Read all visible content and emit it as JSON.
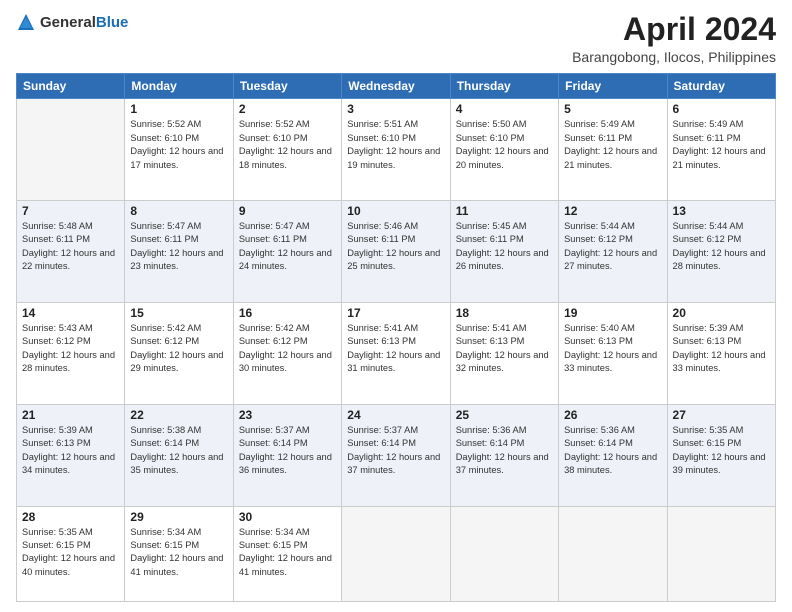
{
  "header": {
    "logo_general": "General",
    "logo_blue": "Blue",
    "month": "April 2024",
    "location": "Barangobong, Ilocos, Philippines"
  },
  "days_of_week": [
    "Sunday",
    "Monday",
    "Tuesday",
    "Wednesday",
    "Thursday",
    "Friday",
    "Saturday"
  ],
  "weeks": [
    [
      {
        "day": "",
        "sunrise": "",
        "sunset": "",
        "daylight": ""
      },
      {
        "day": "1",
        "sunrise": "Sunrise: 5:52 AM",
        "sunset": "Sunset: 6:10 PM",
        "daylight": "Daylight: 12 hours and 17 minutes."
      },
      {
        "day": "2",
        "sunrise": "Sunrise: 5:52 AM",
        "sunset": "Sunset: 6:10 PM",
        "daylight": "Daylight: 12 hours and 18 minutes."
      },
      {
        "day": "3",
        "sunrise": "Sunrise: 5:51 AM",
        "sunset": "Sunset: 6:10 PM",
        "daylight": "Daylight: 12 hours and 19 minutes."
      },
      {
        "day": "4",
        "sunrise": "Sunrise: 5:50 AM",
        "sunset": "Sunset: 6:10 PM",
        "daylight": "Daylight: 12 hours and 20 minutes."
      },
      {
        "day": "5",
        "sunrise": "Sunrise: 5:49 AM",
        "sunset": "Sunset: 6:11 PM",
        "daylight": "Daylight: 12 hours and 21 minutes."
      },
      {
        "day": "6",
        "sunrise": "Sunrise: 5:49 AM",
        "sunset": "Sunset: 6:11 PM",
        "daylight": "Daylight: 12 hours and 21 minutes."
      }
    ],
    [
      {
        "day": "7",
        "sunrise": "Sunrise: 5:48 AM",
        "sunset": "Sunset: 6:11 PM",
        "daylight": "Daylight: 12 hours and 22 minutes."
      },
      {
        "day": "8",
        "sunrise": "Sunrise: 5:47 AM",
        "sunset": "Sunset: 6:11 PM",
        "daylight": "Daylight: 12 hours and 23 minutes."
      },
      {
        "day": "9",
        "sunrise": "Sunrise: 5:47 AM",
        "sunset": "Sunset: 6:11 PM",
        "daylight": "Daylight: 12 hours and 24 minutes."
      },
      {
        "day": "10",
        "sunrise": "Sunrise: 5:46 AM",
        "sunset": "Sunset: 6:11 PM",
        "daylight": "Daylight: 12 hours and 25 minutes."
      },
      {
        "day": "11",
        "sunrise": "Sunrise: 5:45 AM",
        "sunset": "Sunset: 6:11 PM",
        "daylight": "Daylight: 12 hours and 26 minutes."
      },
      {
        "day": "12",
        "sunrise": "Sunrise: 5:44 AM",
        "sunset": "Sunset: 6:12 PM",
        "daylight": "Daylight: 12 hours and 27 minutes."
      },
      {
        "day": "13",
        "sunrise": "Sunrise: 5:44 AM",
        "sunset": "Sunset: 6:12 PM",
        "daylight": "Daylight: 12 hours and 28 minutes."
      }
    ],
    [
      {
        "day": "14",
        "sunrise": "Sunrise: 5:43 AM",
        "sunset": "Sunset: 6:12 PM",
        "daylight": "Daylight: 12 hours and 28 minutes."
      },
      {
        "day": "15",
        "sunrise": "Sunrise: 5:42 AM",
        "sunset": "Sunset: 6:12 PM",
        "daylight": "Daylight: 12 hours and 29 minutes."
      },
      {
        "day": "16",
        "sunrise": "Sunrise: 5:42 AM",
        "sunset": "Sunset: 6:12 PM",
        "daylight": "Daylight: 12 hours and 30 minutes."
      },
      {
        "day": "17",
        "sunrise": "Sunrise: 5:41 AM",
        "sunset": "Sunset: 6:13 PM",
        "daylight": "Daylight: 12 hours and 31 minutes."
      },
      {
        "day": "18",
        "sunrise": "Sunrise: 5:41 AM",
        "sunset": "Sunset: 6:13 PM",
        "daylight": "Daylight: 12 hours and 32 minutes."
      },
      {
        "day": "19",
        "sunrise": "Sunrise: 5:40 AM",
        "sunset": "Sunset: 6:13 PM",
        "daylight": "Daylight: 12 hours and 33 minutes."
      },
      {
        "day": "20",
        "sunrise": "Sunrise: 5:39 AM",
        "sunset": "Sunset: 6:13 PM",
        "daylight": "Daylight: 12 hours and 33 minutes."
      }
    ],
    [
      {
        "day": "21",
        "sunrise": "Sunrise: 5:39 AM",
        "sunset": "Sunset: 6:13 PM",
        "daylight": "Daylight: 12 hours and 34 minutes."
      },
      {
        "day": "22",
        "sunrise": "Sunrise: 5:38 AM",
        "sunset": "Sunset: 6:14 PM",
        "daylight": "Daylight: 12 hours and 35 minutes."
      },
      {
        "day": "23",
        "sunrise": "Sunrise: 5:37 AM",
        "sunset": "Sunset: 6:14 PM",
        "daylight": "Daylight: 12 hours and 36 minutes."
      },
      {
        "day": "24",
        "sunrise": "Sunrise: 5:37 AM",
        "sunset": "Sunset: 6:14 PM",
        "daylight": "Daylight: 12 hours and 37 minutes."
      },
      {
        "day": "25",
        "sunrise": "Sunrise: 5:36 AM",
        "sunset": "Sunset: 6:14 PM",
        "daylight": "Daylight: 12 hours and 37 minutes."
      },
      {
        "day": "26",
        "sunrise": "Sunrise: 5:36 AM",
        "sunset": "Sunset: 6:14 PM",
        "daylight": "Daylight: 12 hours and 38 minutes."
      },
      {
        "day": "27",
        "sunrise": "Sunrise: 5:35 AM",
        "sunset": "Sunset: 6:15 PM",
        "daylight": "Daylight: 12 hours and 39 minutes."
      }
    ],
    [
      {
        "day": "28",
        "sunrise": "Sunrise: 5:35 AM",
        "sunset": "Sunset: 6:15 PM",
        "daylight": "Daylight: 12 hours and 40 minutes."
      },
      {
        "day": "29",
        "sunrise": "Sunrise: 5:34 AM",
        "sunset": "Sunset: 6:15 PM",
        "daylight": "Daylight: 12 hours and 41 minutes."
      },
      {
        "day": "30",
        "sunrise": "Sunrise: 5:34 AM",
        "sunset": "Sunset: 6:15 PM",
        "daylight": "Daylight: 12 hours and 41 minutes."
      },
      {
        "day": "",
        "sunrise": "",
        "sunset": "",
        "daylight": ""
      },
      {
        "day": "",
        "sunrise": "",
        "sunset": "",
        "daylight": ""
      },
      {
        "day": "",
        "sunrise": "",
        "sunset": "",
        "daylight": ""
      },
      {
        "day": "",
        "sunrise": "",
        "sunset": "",
        "daylight": ""
      }
    ]
  ]
}
